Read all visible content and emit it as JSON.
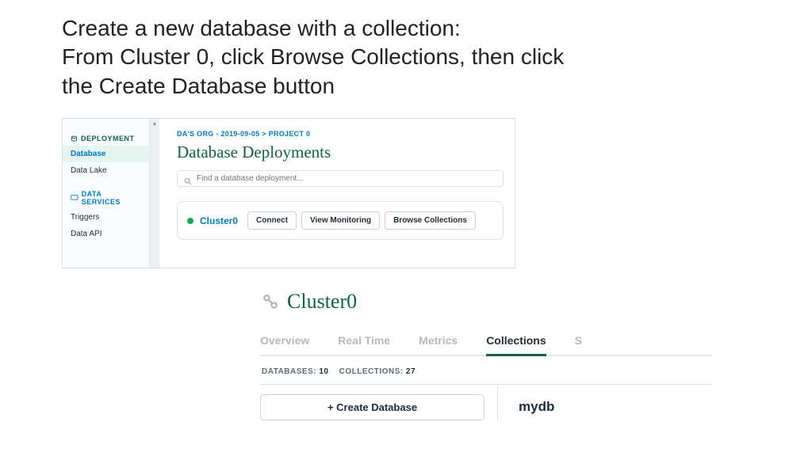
{
  "slide": {
    "line1": "Create a new database with a collection:",
    "line2": "From Cluster 0, click Browse Collections, then click",
    "line3": "the Create Database button"
  },
  "shot1": {
    "sidebar": {
      "section1": "DEPLOYMENT",
      "items1": [
        "Database",
        "Data Lake"
      ],
      "section2": "DATA SERVICES",
      "items2": [
        "Triggers",
        "Data API"
      ]
    },
    "breadcrumb": "DA'S ORG - 2019-09-05 > PROJECT 0",
    "title": "Database Deployments",
    "searchPlaceholder": "Find a database deployment...",
    "cluster": {
      "name": "Cluster0",
      "btnConnect": "Connect",
      "btnMonitor": "View Monitoring",
      "btnBrowse": "Browse Collections"
    }
  },
  "shot2": {
    "title": "Cluster0",
    "tabs": [
      "Overview",
      "Real Time",
      "Metrics",
      "Collections",
      "S"
    ],
    "stats": {
      "dbLabel": "DATABASES:",
      "dbCount": "10",
      "colLabel": "COLLECTIONS:",
      "colCount": "27"
    },
    "createBtn": "+  Create Database",
    "dbname": "mydb"
  }
}
